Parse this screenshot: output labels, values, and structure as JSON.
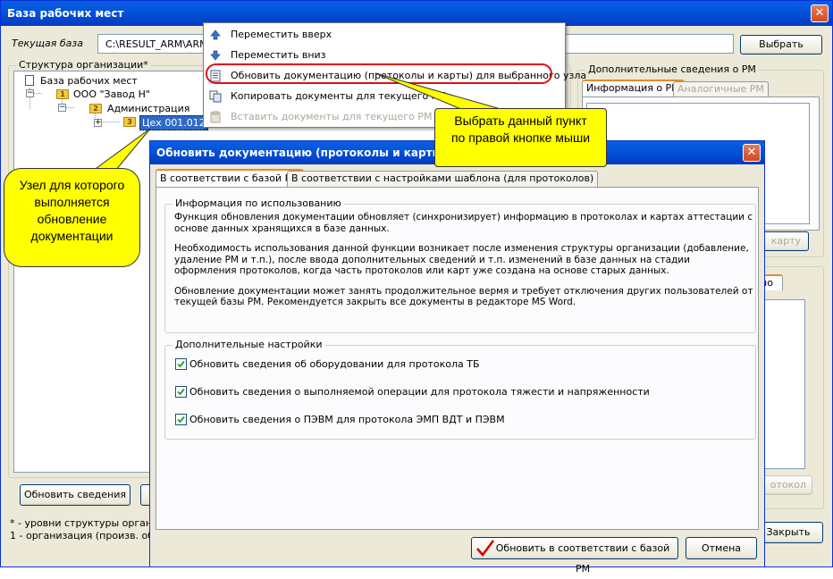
{
  "main_window": {
    "title": "База рабочих мест",
    "current_db_label": "Текущая база",
    "current_db_value": "C:\\RESULT_ARM\\ARM\\",
    "select_button": "Выбрать",
    "org_structure_label": "Структура организации*",
    "tree": {
      "root": "База рабочих мест",
      "org": {
        "badge": "1",
        "label": "ООО \"Завод Н\""
      },
      "admin": {
        "badge": "2",
        "label": "Администрация"
      },
      "shop": {
        "badge": "3",
        "label": "Цех 001.012"
      }
    },
    "extra_info_label": "Дополнительные сведения о РМ",
    "tabs": [
      "Информация о РМ",
      "Аналогичные РМ"
    ],
    "card_button_fragment": "карту",
    "lower_tab_fragment": "но",
    "protocol_button_fragment": "отокол",
    "update_info_button": "Обновить сведения",
    "close_button": "Закрыть",
    "footnote_line1": "* - уровни структуры организа",
    "footnote_line2": "1 - организация (произв. объе"
  },
  "context_menu": {
    "items": [
      {
        "label": "Переместить вверх",
        "icon": "arrow-up-icon",
        "disabled": false
      },
      {
        "label": "Переместить вниз",
        "icon": "arrow-down-icon",
        "disabled": false
      },
      {
        "label": "Обновить документацию (протоколы и карты) для выбранного узла",
        "icon": "document-list-icon",
        "disabled": false
      },
      {
        "label": "Копировать документы для текущего РМ",
        "icon": "copy-icon",
        "disabled": false
      },
      {
        "label": "Вставить документы для текущего РМ",
        "icon": "paste-icon",
        "disabled": true
      }
    ]
  },
  "callouts": {
    "menu_hint": "Выбрать данный пункт по правой кнопке мыши",
    "node_hint": "Узел для которого выполняется обновление документации"
  },
  "dialog": {
    "title": "Обновить документацию (протоколы и карты)",
    "tabs": [
      "В соответствии с базой РМ",
      "В соответствии с настройками шаблона (для протоколов)"
    ],
    "usage_group_label": "Информация по использованию",
    "usage_paragraphs": [
      [
        "Функция обновления документации обновляет (синхронизирует) информацию в протоколах и картах аттестации с",
        "основе данных хранящихся в базе данных."
      ],
      [
        "Необходимость использования данной функции возникает после изменения структуры организации (добавление,",
        "удаление РМ и т.п.), после ввода дополнительных сведений и т.п. изменений в базе данных  на стадии",
        "оформления протоколов, когда часть протоколов или карт уже создана на основе старых данных."
      ],
      [
        "Обновление документации может занять продолжительное вермя и требует отключения других пользователей от",
        "текущей базы РМ. Рекомендуется закрыть все документы в редакторе MS Word."
      ]
    ],
    "extra_settings_label": "Дополнительные настройки",
    "checkboxes": [
      {
        "label": "Обновить сведения об оборудовании для протокола ТБ",
        "checked": true
      },
      {
        "label": "Обновить сведения о выполняемой операции для протокола тяжести и напряженности",
        "checked": true
      },
      {
        "label": "Обновить сведения о ПЭВМ для протокола ЭМП ВДТ и ПЭВМ",
        "checked": true
      }
    ],
    "ok_button": "Обновить в соответствии с базой РМ",
    "cancel_button": "Отмена"
  },
  "colors": {
    "xp_title_blue": "#0454dc",
    "highlight_red": "#e01010",
    "callout_yellow": "#ffff00",
    "checkmark_red": "#cc0000"
  }
}
